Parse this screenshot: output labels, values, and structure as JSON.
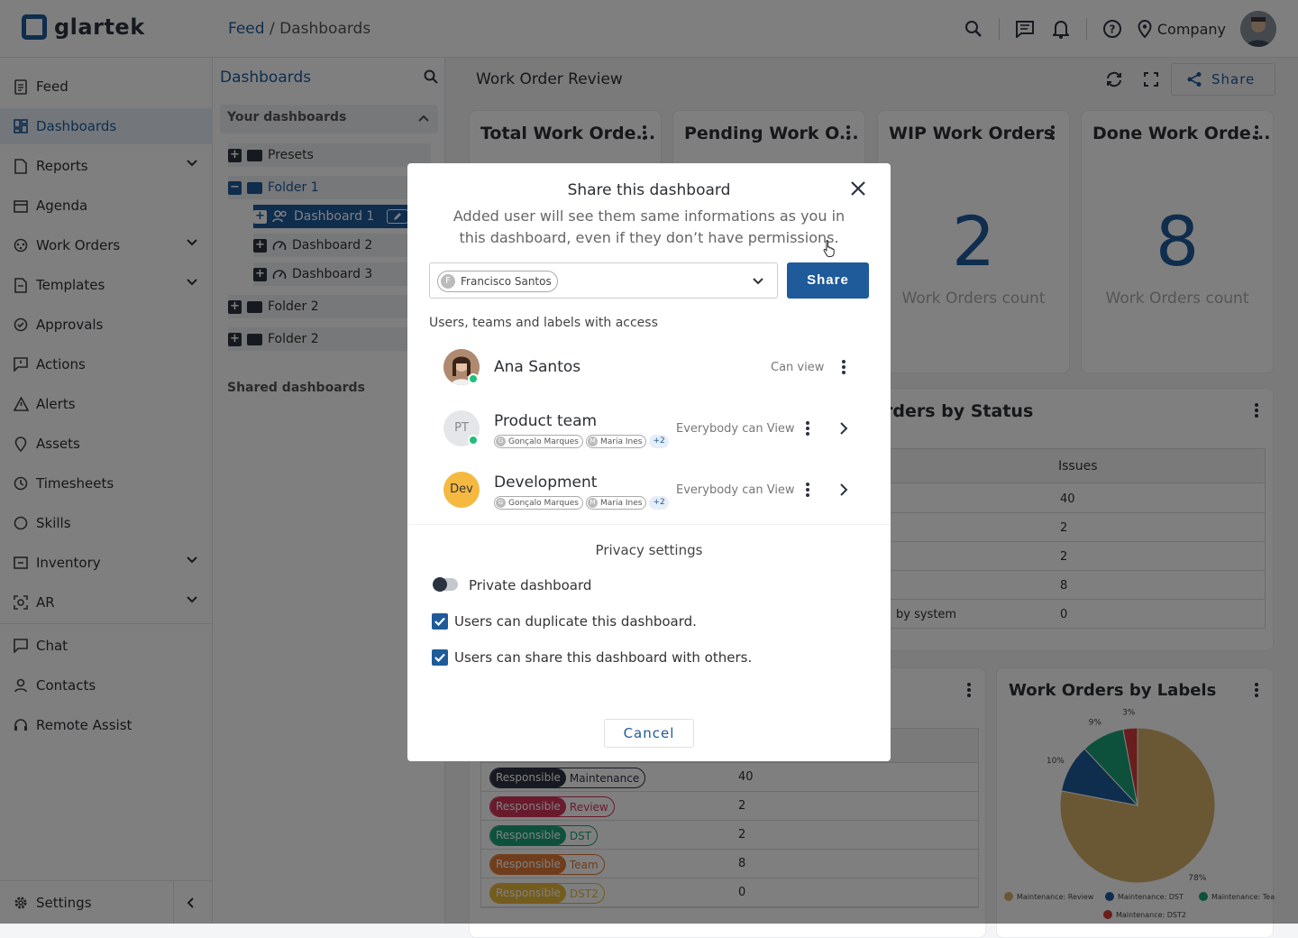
{
  "app": {
    "brand": "glartek"
  },
  "breadcrumb": {
    "root": "Feed",
    "sep": " / ",
    "current": "Dashboards"
  },
  "header": {
    "company": "Company"
  },
  "sidebar": {
    "items": [
      {
        "label": "Feed"
      },
      {
        "label": "Dashboards"
      },
      {
        "label": "Reports"
      },
      {
        "label": "Agenda"
      },
      {
        "label": "Work Orders"
      },
      {
        "label": "Templates"
      },
      {
        "label": "Approvals"
      },
      {
        "label": "Actions"
      },
      {
        "label": "Alerts"
      },
      {
        "label": "Assets"
      },
      {
        "label": "Timesheets"
      },
      {
        "label": "Skills"
      },
      {
        "label": "Inventory"
      },
      {
        "label": "AR"
      },
      {
        "label": "Chat"
      },
      {
        "label": "Contacts"
      },
      {
        "label": "Remote Assist"
      }
    ],
    "settings": "Settings"
  },
  "tree": {
    "title": "Dashboards",
    "your_section": "Your dashboards",
    "shared_section": "Shared dashboards",
    "nodes": [
      {
        "label": "Presets"
      },
      {
        "label": "Folder 1"
      },
      {
        "label": "Dashboard 1"
      },
      {
        "label": "Dashboard 2"
      },
      {
        "label": "Dashboard 3"
      },
      {
        "label": "Folder 2"
      },
      {
        "label": "Folder 2"
      }
    ]
  },
  "main": {
    "title": "Work Order Review",
    "share_label": "Share",
    "kpis": [
      {
        "title": "Total Work Orde..."
      },
      {
        "title": "Pending Work O..."
      },
      {
        "title": "WIP Work Orders",
        "value": "2",
        "sub": "Work Orders count"
      },
      {
        "title": "Done Work Orde...",
        "value": "8",
        "sub": "Work Orders count"
      }
    ],
    "status_card": {
      "title": "rders by Status",
      "issues_header": "Issues",
      "values": [
        "40",
        "2",
        "2",
        "8",
        "0"
      ],
      "system_label": "by system"
    },
    "labels_table": {
      "rows": [
        {
          "tag": "Responsible",
          "label": "Maintenance",
          "value": "40",
          "color": "#2c3340"
        },
        {
          "tag": "Responsible",
          "label": "Review",
          "value": "2",
          "color": "#d2355a"
        },
        {
          "tag": "Responsible",
          "label": "DST",
          "value": "2",
          "color": "#1aa37a"
        },
        {
          "tag": "Responsible",
          "label": "Team",
          "value": "8",
          "color": "#e07b39"
        },
        {
          "tag": "Responsible",
          "label": "DST2",
          "value": "0",
          "color": "#e8b83a"
        }
      ]
    },
    "pie_card": {
      "title": "Work Orders by Labels"
    }
  },
  "chart_data": {
    "type": "pie",
    "title": "Work Orders by Labels",
    "slices": [
      {
        "label": "Maintenance: Review",
        "value": 78,
        "color": "#d4b06a"
      },
      {
        "label": "Maintenance: DST",
        "value": 10,
        "color": "#1f5a9b"
      },
      {
        "label": "Maintenance: Team",
        "value": 9,
        "color": "#1aa37a"
      },
      {
        "label": "Maintenance: DST2",
        "value": 3,
        "color": "#d23a3a"
      }
    ],
    "value_labels": [
      "78%",
      "10%",
      "9%",
      "3%"
    ],
    "legend_position": "bottom"
  },
  "modal": {
    "title": "Share this dashboard",
    "subtitle": "Added user will see them same informations as you in this dashboard, even if they don’t have permissions.",
    "selected_user": "Francisco Santos",
    "selected_initial": "F",
    "share_button": "Share",
    "access_header": "Users, teams and labels with access",
    "entries": [
      {
        "name": "Ana Santos",
        "permission": "Can view"
      },
      {
        "name": "Product team",
        "initials": "PT",
        "permission": "Everybody can View",
        "members": [
          "Gonçalo Marques",
          "Maria Ines"
        ],
        "member_initials": [
          "G",
          "M"
        ],
        "more": "+2"
      },
      {
        "name": "Development",
        "initials": "Dev",
        "permission": "Everybody can View",
        "members": [
          "Gonçalo Marques",
          "Maria Ines"
        ],
        "member_initials": [
          "G",
          "M"
        ],
        "more": "+2"
      }
    ],
    "privacy_header": "Privacy settings",
    "private_label": "Private dashboard",
    "duplicate_label": "Users can duplicate this dashboard.",
    "share_others_label": "Users can share this dashboard with others.",
    "cancel": "Cancel"
  },
  "colors": {
    "primary": "#1f5a9b",
    "online": "#1fbf7a",
    "dev_avatar": "#f5b942"
  }
}
